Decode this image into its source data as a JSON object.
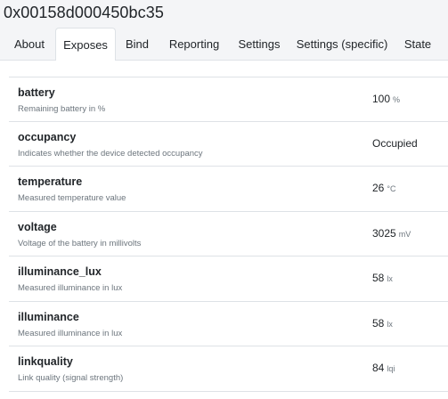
{
  "device": {
    "title": "0x00158d000450bc35"
  },
  "tabs": [
    {
      "label": "About",
      "active": false
    },
    {
      "label": "Exposes",
      "active": true
    },
    {
      "label": "Bind",
      "active": false
    },
    {
      "label": "Reporting",
      "active": false
    },
    {
      "label": "Settings",
      "active": false
    },
    {
      "label": "Settings (specific)",
      "active": false
    },
    {
      "label": "State",
      "active": false
    }
  ],
  "exposes": [
    {
      "name": "battery",
      "description": "Remaining battery in %",
      "value": "100",
      "unit": "%"
    },
    {
      "name": "occupancy",
      "description": "Indicates whether the device detected occupancy",
      "value": "Occupied",
      "unit": ""
    },
    {
      "name": "temperature",
      "description": "Measured temperature value",
      "value": "26",
      "unit": "°C"
    },
    {
      "name": "voltage",
      "description": "Voltage of the battery in millivolts",
      "value": "3025",
      "unit": "mV"
    },
    {
      "name": "illuminance_lux",
      "description": "Measured illuminance in lux",
      "value": "58",
      "unit": "lx"
    },
    {
      "name": "illuminance",
      "description": "Measured illuminance in lux",
      "value": "58",
      "unit": "lx"
    },
    {
      "name": "linkquality",
      "description": "Link quality (signal strength)",
      "value": "84",
      "unit": "lqi"
    }
  ]
}
